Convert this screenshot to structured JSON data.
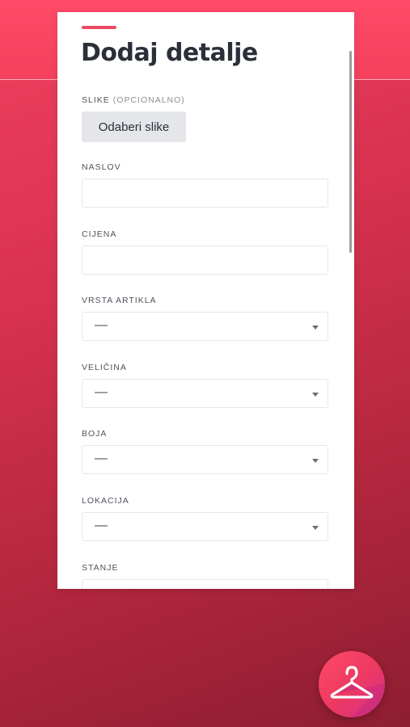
{
  "form": {
    "title": "Dodaj detalje",
    "images": {
      "label": "SLIKE",
      "optional": "(OPCIONALNO)",
      "button": "Odaberi slike"
    },
    "fields": [
      {
        "label": "NASLOV",
        "type": "text",
        "value": ""
      },
      {
        "label": "CIJENA",
        "type": "text",
        "value": ""
      },
      {
        "label": "VRSTA ARTIKLA",
        "type": "select",
        "value": "—"
      },
      {
        "label": "VELIČINA",
        "type": "select",
        "value": "—"
      },
      {
        "label": "BOJA",
        "type": "select",
        "value": "—"
      },
      {
        "label": "LOKACIJA",
        "type": "select",
        "value": "—"
      },
      {
        "label": "STANJE",
        "type": "select",
        "value": ""
      }
    ]
  },
  "fab": {
    "icon": "hanger-icon"
  },
  "colors": {
    "accent": "#e94b63",
    "background_top": "#ff4b68",
    "background_bottom": "#8e1d31",
    "title": "#2b2f3a"
  }
}
